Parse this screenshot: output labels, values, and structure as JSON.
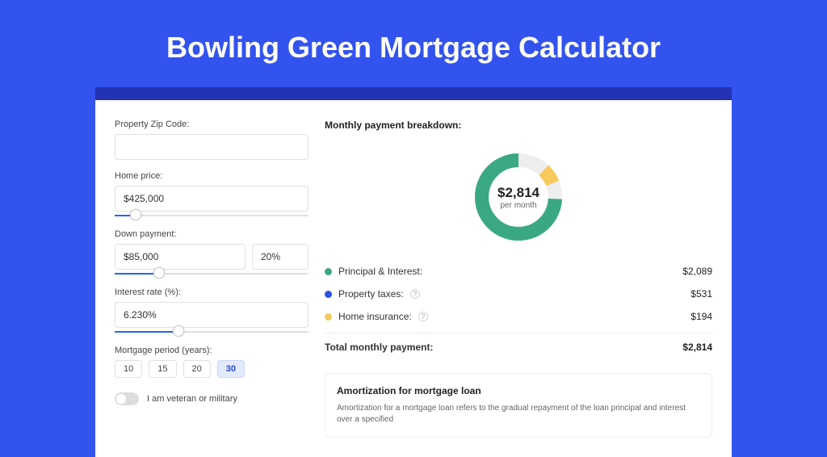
{
  "page_title": "Bowling Green Mortgage Calculator",
  "form": {
    "zip": {
      "label": "Property Zip Code:",
      "value": ""
    },
    "home_price": {
      "label": "Home price:",
      "value": "$425,000",
      "slider_pct": 8
    },
    "down_payment": {
      "label": "Down payment:",
      "amount_value": "$85,000",
      "percent_value": "20%",
      "slider_pct": 20
    },
    "interest_rate": {
      "label": "Interest rate (%):",
      "value": "6.230%",
      "slider_pct": 30
    },
    "period": {
      "label": "Mortgage period (years):",
      "options": [
        "10",
        "15",
        "20",
        "30"
      ],
      "selected": "30"
    },
    "veteran": {
      "label": "I am veteran or military",
      "checked": false
    }
  },
  "breakdown": {
    "title": "Monthly payment breakdown:",
    "center_amount": "$2,814",
    "center_sub": "per month",
    "rows": [
      {
        "name": "Principal & Interest:",
        "value": "$2,089",
        "color": "#3aa981",
        "help": false
      },
      {
        "name": "Property taxes:",
        "value": "$531",
        "color": "#2c51e3",
        "help": true
      },
      {
        "name": "Home insurance:",
        "value": "$194",
        "color": "#f6c95c",
        "help": true
      }
    ],
    "total_label": "Total monthly payment:",
    "total_value": "$2,814"
  },
  "chart_data": {
    "type": "pie",
    "title": "Monthly payment breakdown",
    "series": [
      {
        "name": "Principal & Interest",
        "value": 2089,
        "color": "#3aa981"
      },
      {
        "name": "Property taxes",
        "value": 531,
        "color": "#2c51e3"
      },
      {
        "name": "Home insurance",
        "value": 194,
        "color": "#f6c95c"
      }
    ],
    "center_label": "$2,814",
    "center_sub": "per month"
  },
  "amortization": {
    "title": "Amortization for mortgage loan",
    "text": "Amortization for a mortgage loan refers to the gradual repayment of the loan principal and interest over a specified"
  }
}
